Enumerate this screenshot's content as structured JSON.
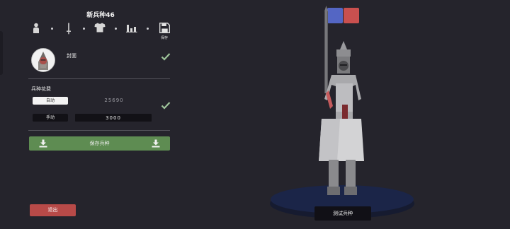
{
  "unit_title": "新兵种46",
  "toolbar": {
    "steps": [
      {
        "icon": "figure-icon"
      },
      {
        "icon": "sword-icon"
      },
      {
        "icon": "shirt-icon"
      },
      {
        "icon": "stats-icon"
      },
      {
        "icon": "save-disk-icon",
        "label": "保存"
      }
    ]
  },
  "cover": {
    "label": "封面",
    "checked": true
  },
  "cost": {
    "label": "兵种花费",
    "auto_label": "自动",
    "auto_value": "25690",
    "manual_label": "手动",
    "manual_value": "3000",
    "checked": true
  },
  "save_button": {
    "label": "保存兵种"
  },
  "exit_button": {
    "label": "退出"
  },
  "test_button": {
    "label": "测试兵种"
  },
  "team_colors": {
    "blue": "#5466c4",
    "red": "#c9504f"
  },
  "colors": {
    "background": "#25242c",
    "save_green": "#5e8c52",
    "exit_red": "#b84a48",
    "stage_blue": "#1b2548"
  }
}
